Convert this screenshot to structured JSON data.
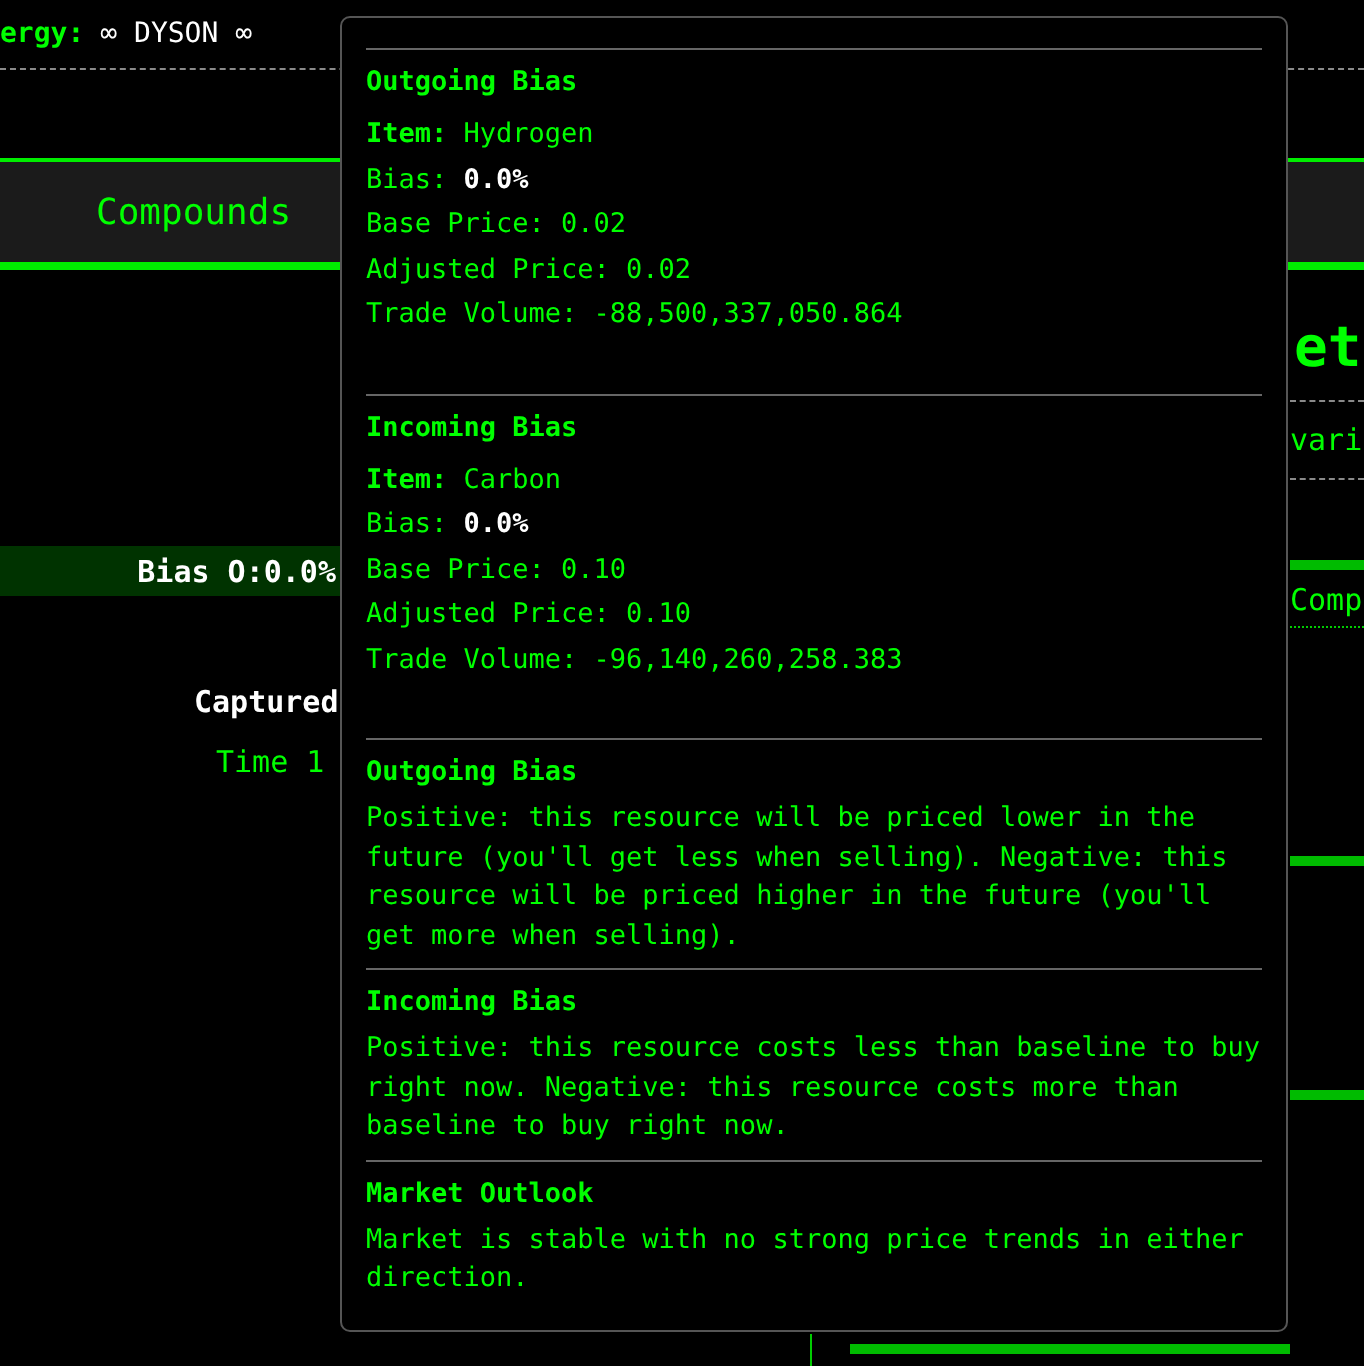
{
  "header": {
    "label": "ergy:",
    "value": "∞ DYSON ∞"
  },
  "tabs": [
    {
      "label": "Compounds"
    }
  ],
  "left_panel": {
    "bias": "Bias O:0.0%",
    "captured": "Captured",
    "time": "Time 1"
  },
  "right_panel": {
    "heading": "et",
    "text_1": "vari",
    "text_2": "Comp"
  },
  "tooltip": {
    "sections": [
      {
        "kind": "detail",
        "title": "Outgoing Bias",
        "item_label": "Item:",
        "item": "Hydrogen",
        "bias_label": "Bias:",
        "bias": "0.0%",
        "lines": [
          "Base Price: 0.02",
          "Adjusted Price: 0.02",
          "Trade Volume: -88,500,337,050.864"
        ]
      },
      {
        "kind": "detail",
        "title": "Incoming Bias",
        "item_label": "Item:",
        "item": "Carbon",
        "bias_label": "Bias:",
        "bias": "0.0%",
        "lines": [
          "Base Price: 0.10",
          "Adjusted Price: 0.10",
          "Trade Volume: -96,140,260,258.383"
        ]
      },
      {
        "kind": "note",
        "title": "Outgoing Bias",
        "text": "Positive: this resource will be priced lower in the future (you'll get less when selling). Negative: this resource will be priced higher in the future (you'll get more when selling)."
      },
      {
        "kind": "note",
        "title": "Incoming Bias",
        "text": "Positive: this resource costs less than baseline to buy right now. Negative: this resource costs more than baseline to buy right now."
      },
      {
        "kind": "note",
        "title": "Market Outlook",
        "text": "Market is stable with no strong price trends in either direction."
      }
    ]
  }
}
